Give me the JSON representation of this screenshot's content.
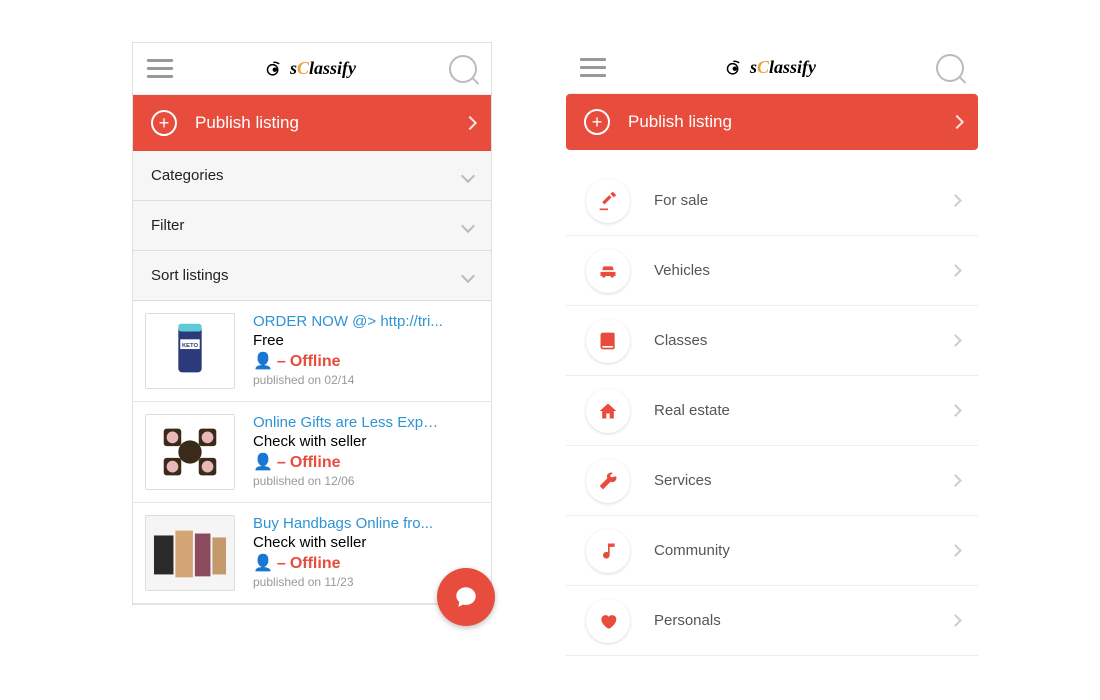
{
  "brand_text": "sClassify",
  "publish_label": "Publish listing",
  "sections": {
    "categories": "Categories",
    "filter": "Filter",
    "sort": "Sort listings"
  },
  "status_offline": "Offline",
  "listings": [
    {
      "title": "ORDER NOW @> http://tri...",
      "price": "Free",
      "published": "published on 02/14",
      "thumb": "keto"
    },
    {
      "title": "Online Gifts are Less Expe...",
      "price": "Check with seller",
      "published": "published on 12/06",
      "thumb": "clock"
    },
    {
      "title": "Buy Handbags Online fro...",
      "price": "Check with seller",
      "published": "published on 11/23",
      "thumb": "bags"
    }
  ],
  "categories": [
    {
      "icon": "gavel",
      "label": "For sale"
    },
    {
      "icon": "car",
      "label": "Vehicles"
    },
    {
      "icon": "book",
      "label": "Classes"
    },
    {
      "icon": "home",
      "label": "Real estate"
    },
    {
      "icon": "wrench",
      "label": "Services"
    },
    {
      "icon": "music",
      "label": "Community"
    },
    {
      "icon": "heart",
      "label": "Personals"
    }
  ]
}
